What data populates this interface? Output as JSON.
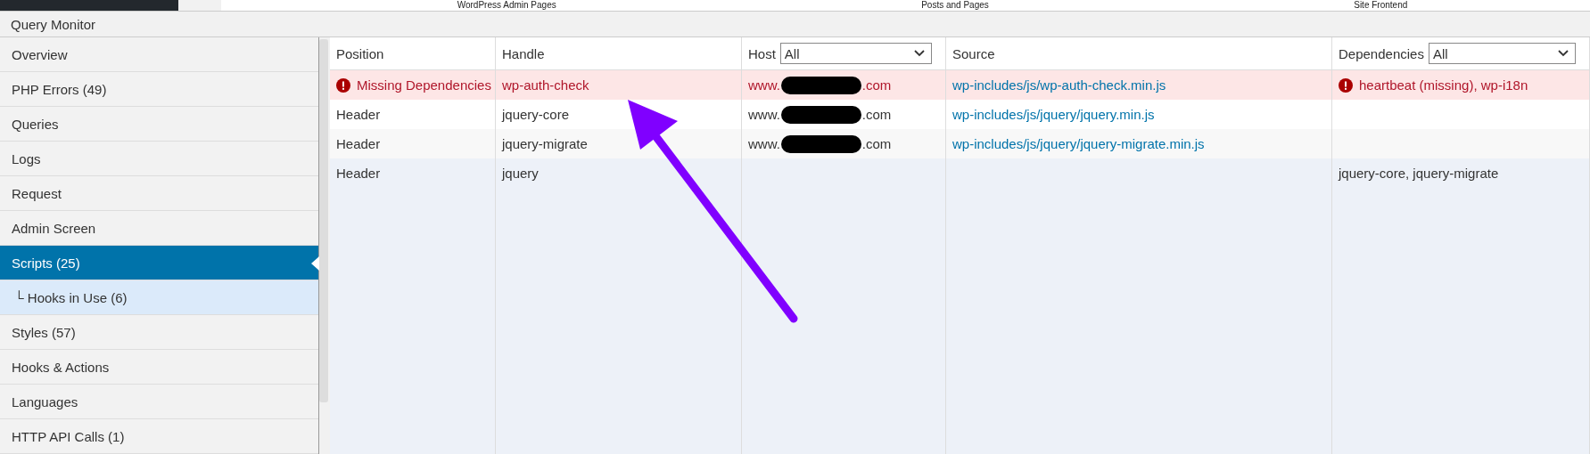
{
  "top_tabs": [
    "WordPress Admin Pages",
    "Posts and Pages",
    "Site Frontend"
  ],
  "window": {
    "title": "Query Monitor"
  },
  "sidebar": {
    "items": [
      {
        "label": "Overview",
        "selected": false
      },
      {
        "label": "PHP Errors (49)",
        "selected": false
      },
      {
        "label": "Queries",
        "selected": false
      },
      {
        "label": "Logs",
        "selected": false
      },
      {
        "label": "Request",
        "selected": false
      },
      {
        "label": "Admin Screen",
        "selected": false
      },
      {
        "label": "Scripts (25)",
        "selected": true,
        "children": [
          {
            "marker": "└",
            "label": "Hooks in Use (6)",
            "selected": false
          }
        ]
      },
      {
        "label": "Styles (57)",
        "selected": false
      },
      {
        "label": "Hooks & Actions",
        "selected": false
      },
      {
        "label": "Languages",
        "selected": false
      },
      {
        "label": "HTTP API Calls (1)",
        "selected": false
      }
    ]
  },
  "table": {
    "columns": [
      {
        "label": "Position"
      },
      {
        "label": "Handle"
      },
      {
        "label": "Host",
        "filter": "All"
      },
      {
        "label": "Source"
      },
      {
        "label": "Dependencies",
        "filter": "All"
      }
    ],
    "rows": [
      {
        "kind": "error",
        "position": "Missing Dependencies",
        "position_warning": true,
        "handle": "wp-auth-check",
        "host": {
          "prefix": "www.",
          "suffix": ".com"
        },
        "source": "wp-includes/js/wp-auth-check.min.js",
        "dependencies": "heartbeat (missing), wp-i18n",
        "dependencies_warning": true
      },
      {
        "kind": "normal",
        "position": "Header",
        "position_warning": false,
        "handle": "jquery-core",
        "host": {
          "prefix": "www.",
          "suffix": ".com"
        },
        "source": "wp-includes/js/jquery/jquery.min.js",
        "dependencies_warning": false
      },
      {
        "kind": "alt",
        "position": "Header",
        "position_warning": false,
        "handle": "jquery-migrate",
        "host": {
          "prefix": "www.",
          "suffix": ".com"
        },
        "source": "wp-includes/js/jquery/jquery-migrate.min.js",
        "dependencies_warning": false
      },
      {
        "kind": "highlight",
        "position": "Header",
        "position_warning": false,
        "handle": "jquery",
        "dependencies": "jquery-core, jquery-migrate",
        "dependencies_warning": false
      }
    ]
  }
}
